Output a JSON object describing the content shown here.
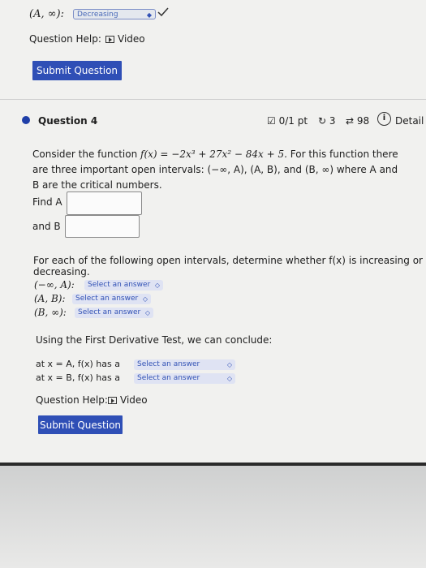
{
  "top": {
    "interval_prefix": "(A, ∞):",
    "dropdown_value": "Decreasing",
    "question_help_label": "Question Help:",
    "video_label": "Video",
    "submit_label": "Submit Question"
  },
  "question": {
    "number_label": "Question 4",
    "score": "0/1 pt",
    "attempts": "3",
    "tries": "98",
    "details_label": "Detail"
  },
  "problem": {
    "line1_prefix": "Consider the function",
    "function_expr": "f(x) = −2x³ + 27x² − 84x + 5.",
    "line1_suffix": "For this function there",
    "line2": "are three important open intervals: (−∞, A), (A, B), and (B, ∞) where A and",
    "line3": "B are the critical numbers.",
    "find_a_label": "Find A",
    "and_b_label": "and B",
    "intervals_intro_1": "For each of the following open intervals, determine whether f(x) is increasing or",
    "intervals_intro_2": "decreasing.",
    "intervals": [
      {
        "label": "(−∞, A):",
        "select_placeholder": "Select an answer"
      },
      {
        "label": "(A, B):",
        "select_placeholder": "Select an answer"
      },
      {
        "label": "(B, ∞):",
        "select_placeholder": "Select an answer"
      }
    ],
    "first_derivative_intro": "Using the First Derivative Test, we can conclude:",
    "conclusions": [
      {
        "prefix": "at x = A, f(x) has a",
        "select_placeholder": "Select an answer"
      },
      {
        "prefix": "at x = B, f(x) has a",
        "select_placeholder": "Select an answer"
      }
    ],
    "question_help_label": "Question Help:",
    "video_label": "Video",
    "submit_label": "Submit Question"
  },
  "colors": {
    "accent": "#2f4fb6",
    "select_bg": "#dfe3f3",
    "bullet": "#1f3fa8"
  }
}
